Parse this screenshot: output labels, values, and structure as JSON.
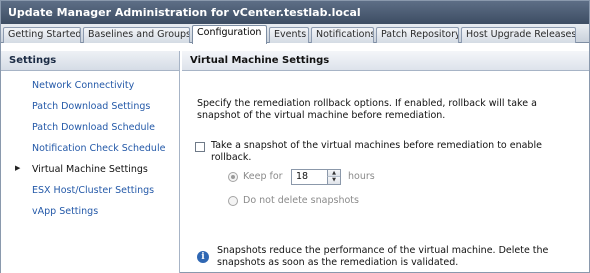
{
  "window": {
    "title": "Update Manager Administration for vCenter.testlab.local"
  },
  "tabs": [
    {
      "label": "Getting Started"
    },
    {
      "label": "Baselines and Groups"
    },
    {
      "label": "Configuration",
      "active": true
    },
    {
      "label": "Events"
    },
    {
      "label": "Notifications"
    },
    {
      "label": "Patch Repository"
    },
    {
      "label": "Host Upgrade Releases"
    }
  ],
  "sidebar": {
    "header": "Settings",
    "items": [
      {
        "label": "Network Connectivity"
      },
      {
        "label": "Patch Download Settings"
      },
      {
        "label": "Patch Download Schedule"
      },
      {
        "label": "Notification Check Schedule"
      },
      {
        "label": "Virtual Machine Settings",
        "selected": true
      },
      {
        "label": "ESX Host/Cluster Settings"
      },
      {
        "label": "vApp Settings"
      }
    ]
  },
  "main": {
    "header": "Virtual Machine Settings",
    "description_line1": "Specify the remediation rollback options.  If enabled, rollback will take a",
    "description_line2": "snapshot of the virtual machine before remediation.",
    "snapshot_checkbox_line1": "Take a snapshot of the virtual machines before remediation to enable",
    "snapshot_checkbox_line2": "rollback.",
    "snapshot_checked": false,
    "keep_for_label": "Keep for",
    "keep_for_value": "18",
    "hours_label": "hours",
    "do_not_delete_label": "Do not delete snapshots",
    "info_line1": "Snapshots reduce the performance of the virtual machine.  Delete the",
    "info_line2": "snapshots as soon as the remediation is validated."
  },
  "colors": {
    "titlebar": "#4a5a70",
    "link": "#2459a8",
    "info_icon": "#2f67b3"
  },
  "icons": {
    "selected_marker": "triangle-right-icon",
    "info": "info-icon",
    "spinner_up": "chevron-up-icon",
    "spinner_down": "chevron-down-icon"
  }
}
